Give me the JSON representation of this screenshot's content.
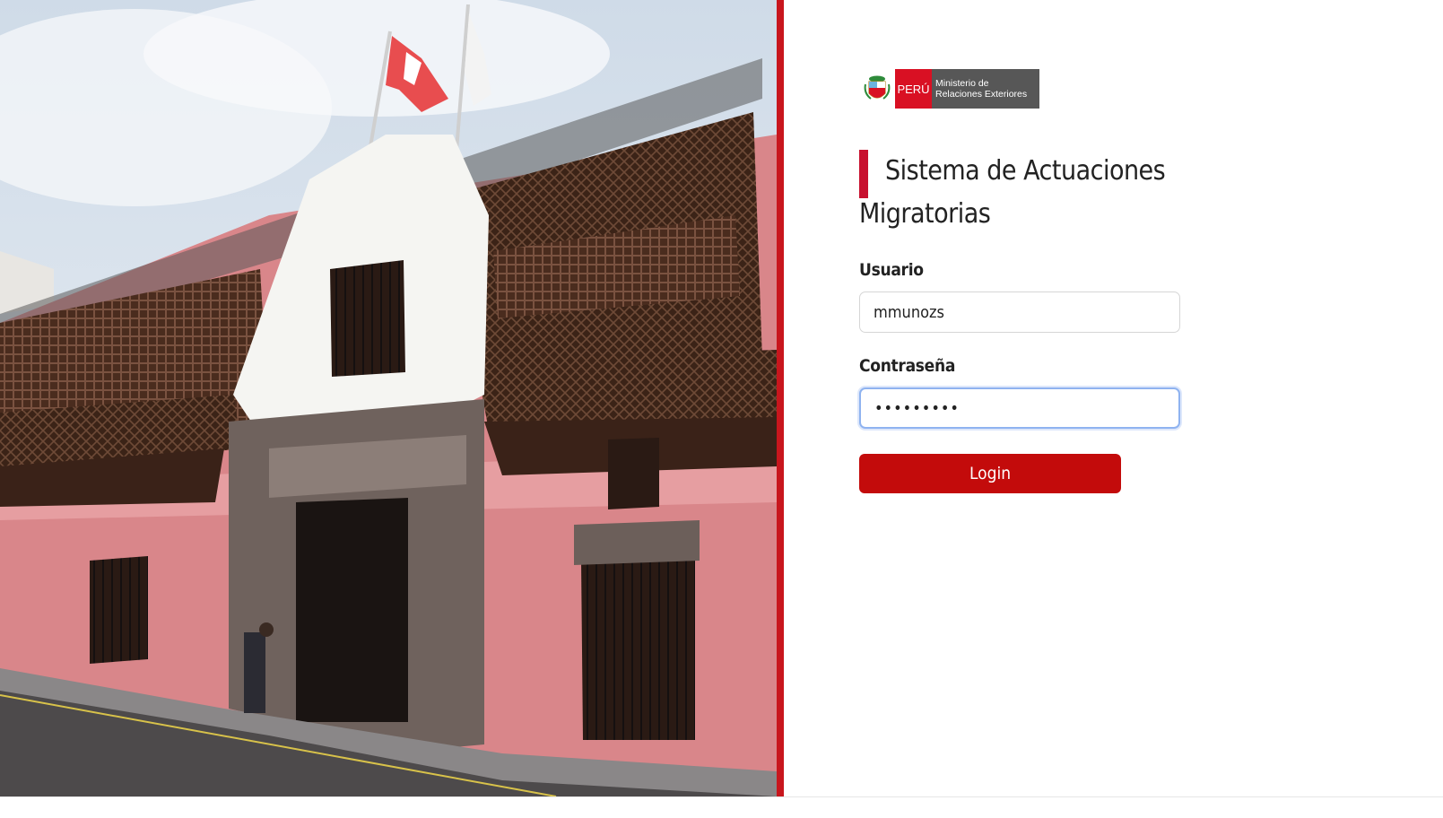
{
  "logo": {
    "country": "PERÚ",
    "ministry_line1": "Ministerio de",
    "ministry_line2": "Relaciones Exteriores"
  },
  "title": "Sistema de Actuaciones Migratorias",
  "form": {
    "username_label": "Usuario",
    "username_value": "mmunozs",
    "password_label": "Contraseña",
    "password_value": "•••••••••",
    "login_label": "Login"
  },
  "colors": {
    "accent_red": "#c8161d",
    "button_red": "#c30b0b",
    "title_bar": "#c8102e",
    "peru_red": "#d91023",
    "ministry_gray": "#575757",
    "building_pink": "#d9868a",
    "balcony_brown": "#4a2c1e"
  },
  "background_image": "building-photo"
}
